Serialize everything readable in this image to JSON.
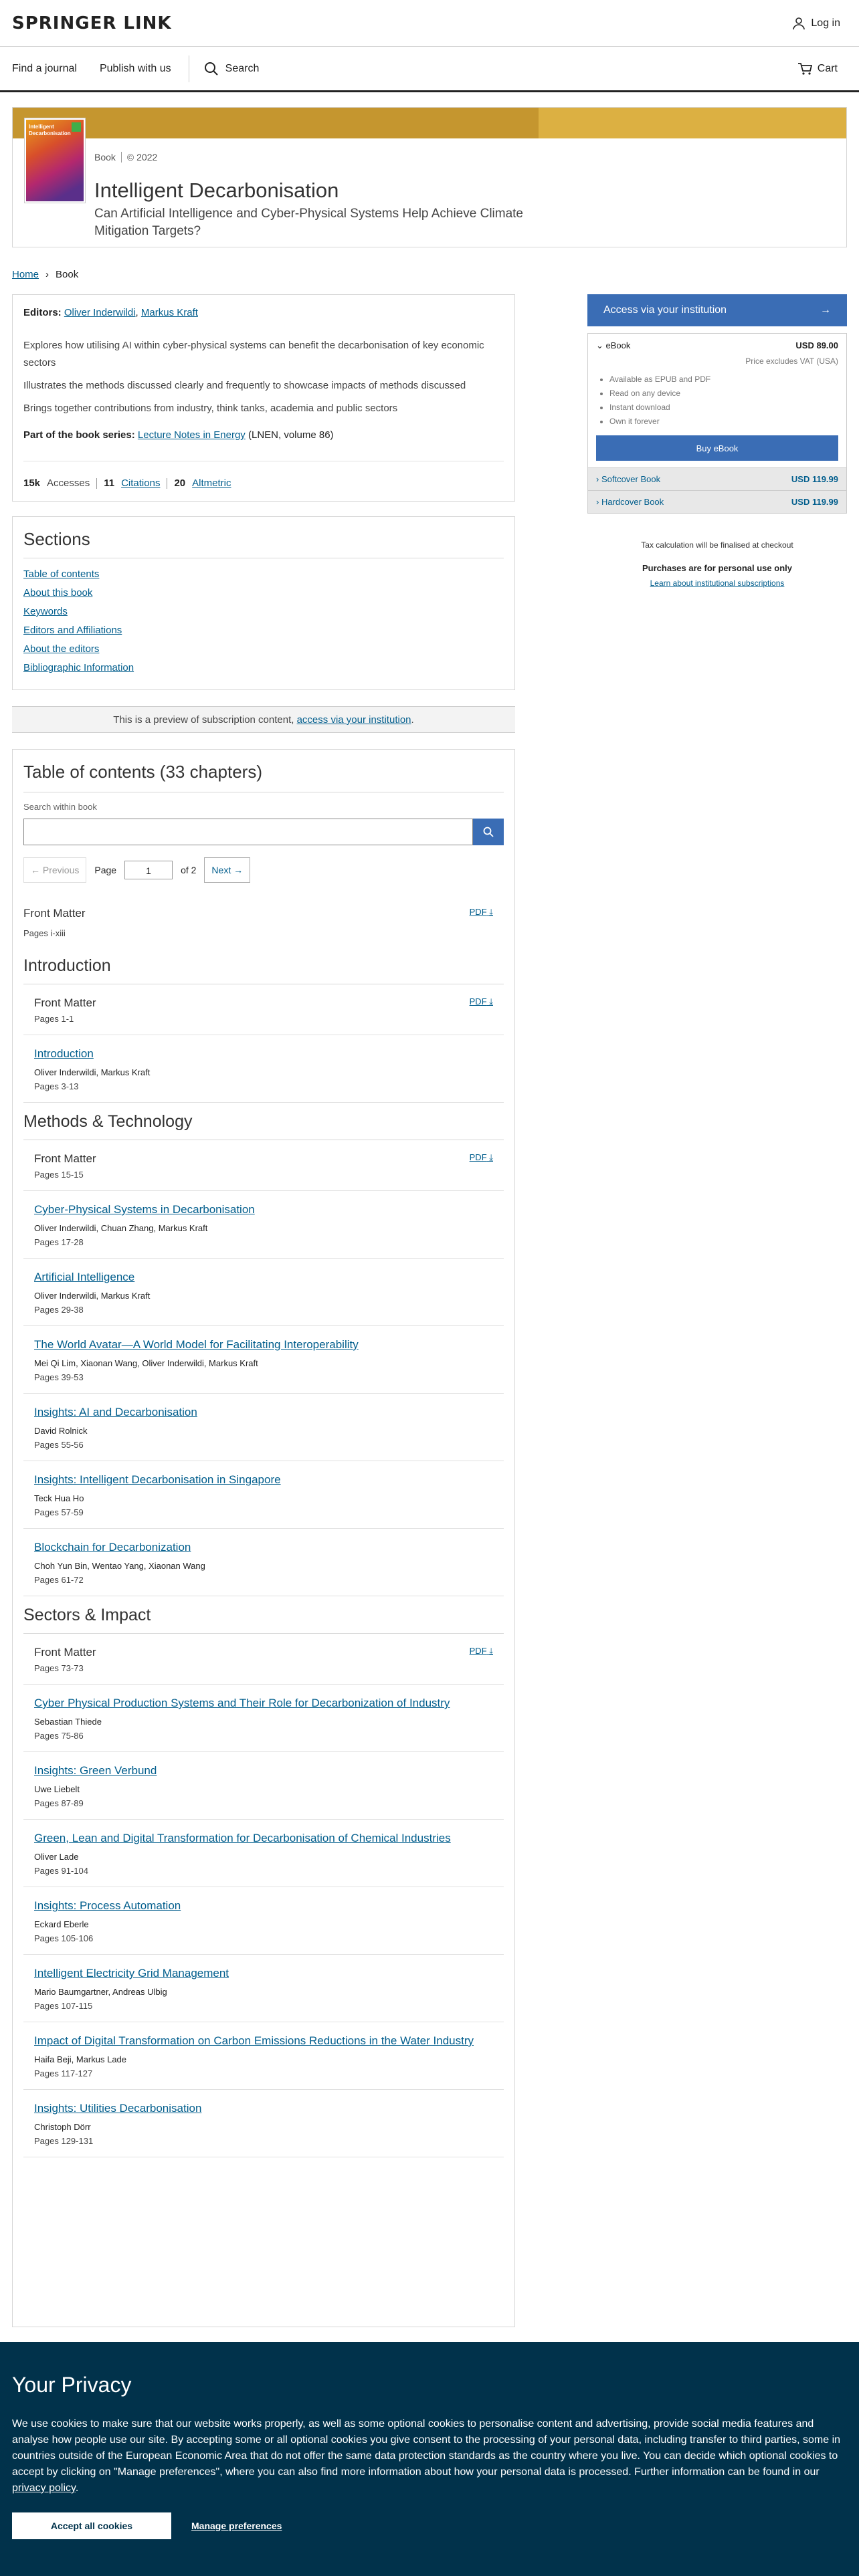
{
  "header": {
    "logo": "SPRINGER LINK",
    "login": "Log in"
  },
  "nav": {
    "find_journal": "Find a journal",
    "publish": "Publish with us",
    "search": "Search",
    "cart": "Cart"
  },
  "book": {
    "type": "Book",
    "year": "© 2022",
    "title": "Intelligent Decarbonisation",
    "subtitle": "Can Artificial Intelligence and Cyber-Physical Systems Help Achieve Climate Mitigation Targets?",
    "cover_title": "Intelligent Decarbonisation"
  },
  "breadcrumb": {
    "home": "Home",
    "current": "Book"
  },
  "editors": {
    "label": "Editors:",
    "names": [
      "Oliver Inderwildi",
      "Markus Kraft"
    ]
  },
  "bullets": [
    "Explores how utilising AI within cyber-physical systems can benefit the decarbonisation of key economic sectors",
    "Illustrates the methods discussed clearly and frequently to showcase impacts of methods discussed",
    "Brings together contributions from industry, think tanks, academia and public sectors"
  ],
  "series": {
    "label": "Part of the book series:",
    "name": "Lecture Notes in Energy",
    "suffix": "(LNEN, volume 86)"
  },
  "metrics": {
    "accesses_value": "15k",
    "accesses_label": "Accesses",
    "citations_value": "11",
    "citations_label": "Citations",
    "altmetric_value": "20",
    "altmetric_label": "Altmetric"
  },
  "sections": {
    "heading": "Sections",
    "links": [
      "Table of contents",
      "About this book",
      "Keywords",
      "Editors and Affiliations",
      "About the editors",
      "Bibliographic Information"
    ]
  },
  "preview": {
    "text": "This is a preview of subscription content,",
    "link": "access via your institution",
    "end": "."
  },
  "toc": {
    "heading": "Table of contents (33 chapters)",
    "search_label": "Search within book",
    "prev": "Previous",
    "page_label": "Page",
    "page_value": "1",
    "of": "of 2",
    "next": "Next",
    "pdf": "PDF",
    "front_matter": {
      "title": "Front Matter",
      "pages": "Pages i-xiii"
    },
    "parts": [
      {
        "heading": "Introduction",
        "chapters": [
          {
            "title": "Front Matter",
            "authors": "",
            "pages": "Pages 1-1",
            "pdf": true
          },
          {
            "title": "Introduction",
            "authors": "Oliver Inderwildi, Markus Kraft",
            "pages": "Pages 3-13"
          }
        ]
      },
      {
        "heading": "Methods & Technology",
        "chapters": [
          {
            "title": "Front Matter",
            "authors": "",
            "pages": "Pages 15-15",
            "pdf": true
          },
          {
            "title": "Cyber-Physical Systems in Decarbonisation",
            "authors": "Oliver Inderwildi, Chuan Zhang, Markus Kraft",
            "pages": "Pages 17-28"
          },
          {
            "title": "Artificial Intelligence",
            "authors": "Oliver Inderwildi, Markus Kraft",
            "pages": "Pages 29-38"
          },
          {
            "title": "The World Avatar—A World Model for Facilitating Interoperability",
            "authors": "Mei Qi Lim, Xiaonan Wang, Oliver Inderwildi, Markus Kraft",
            "pages": "Pages 39-53"
          },
          {
            "title": "Insights: AI and Decarbonisation",
            "authors": "David Rolnick",
            "pages": "Pages 55-56"
          },
          {
            "title": "Insights: Intelligent Decarbonisation in Singapore",
            "authors": "Teck Hua Ho",
            "pages": "Pages 57-59"
          },
          {
            "title": "Blockchain for Decarbonization",
            "authors": "Choh Yun Bin, Wentao Yang, Xiaonan Wang",
            "pages": "Pages 61-72"
          }
        ]
      },
      {
        "heading": "Sectors & Impact",
        "chapters": [
          {
            "title": "Front Matter",
            "authors": "",
            "pages": "Pages 73-73",
            "pdf": true
          },
          {
            "title": "Cyber Physical Production Systems and Their Role for Decarbonization of Industry",
            "authors": "Sebastian Thiede",
            "pages": "Pages 75-86"
          },
          {
            "title": "Insights: Green Verbund",
            "authors": "Uwe Liebelt",
            "pages": "Pages 87-89"
          },
          {
            "title": "Green, Lean and Digital Transformation for Decarbonisation of Chemical Industries",
            "authors": "Oliver Lade",
            "pages": "Pages 91-104"
          },
          {
            "title": "Insights: Process Automation",
            "authors": "Eckard Eberle",
            "pages": "Pages 105-106"
          },
          {
            "title": "Intelligent Electricity Grid Management",
            "authors": "Mario Baumgartner, Andreas Ulbig",
            "pages": "Pages 107-115"
          },
          {
            "title": "Impact of Digital Transformation on Carbon Emissions Reductions in the Water Industry",
            "authors": "Haifa Beji, Markus Lade",
            "pages": "Pages 117-127"
          },
          {
            "title": "Insights: Utilities Decarbonisation",
            "authors": "Christoph Dörr",
            "pages": "Pages 129-131"
          }
        ]
      }
    ]
  },
  "sidebar": {
    "access": "Access via your institution",
    "ebook": {
      "label": "eBook",
      "price": "USD 89.00",
      "vat": "Price excludes VAT (USA)",
      "features": [
        "Available as EPUB and PDF",
        "Read on any device",
        "Instant download",
        "Own it forever"
      ],
      "buy": "Buy eBook"
    },
    "softcover": {
      "label": "Softcover Book",
      "price": "USD 119.99"
    },
    "hardcover": {
      "label": "Hardcover Book",
      "price": "USD 119.99"
    },
    "tax_note": "Tax calculation will be finalised at checkout",
    "personal": "Purchases are for personal use only",
    "institutional": "Learn about institutional subscriptions"
  },
  "cookie": {
    "title": "Your Privacy",
    "text": "We use cookies to make sure that our website works properly, as well as some optional cookies to personalise content and advertising, provide social media features and analyse how people use our site. By accepting some or all optional cookies you give consent to the processing of your personal data, including transfer to third parties, some in countries outside of the European Economic Area that do not offer the same data protection standards as the country where you live. You can decide which optional cookies to accept by clicking on \"Manage preferences\", where you can also find more information about how your personal data is processed. Further information can be found in our",
    "policy": "privacy policy",
    "end": ".",
    "accept": "Accept all cookies",
    "manage": "Manage preferences"
  },
  "colors": {
    "brand_blue": "#3a6db5",
    "link": "#025e8d",
    "hero_gold": "#c5962f",
    "cookie_bg": "#01324b"
  }
}
